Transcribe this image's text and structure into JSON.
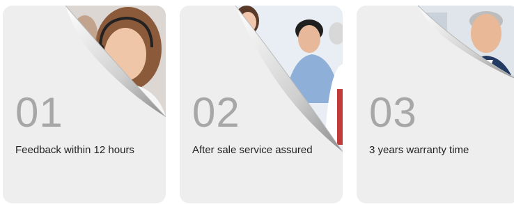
{
  "cards": [
    {
      "number": "01",
      "text": "Feedback within 12 hours"
    },
    {
      "number": "02",
      "text": "After sale service assured"
    },
    {
      "number": "03",
      "text": "3 years warranty time"
    }
  ],
  "colors": {
    "card_bg": "#eeeeee",
    "number": "#a7a7a7",
    "text": "#222222"
  }
}
